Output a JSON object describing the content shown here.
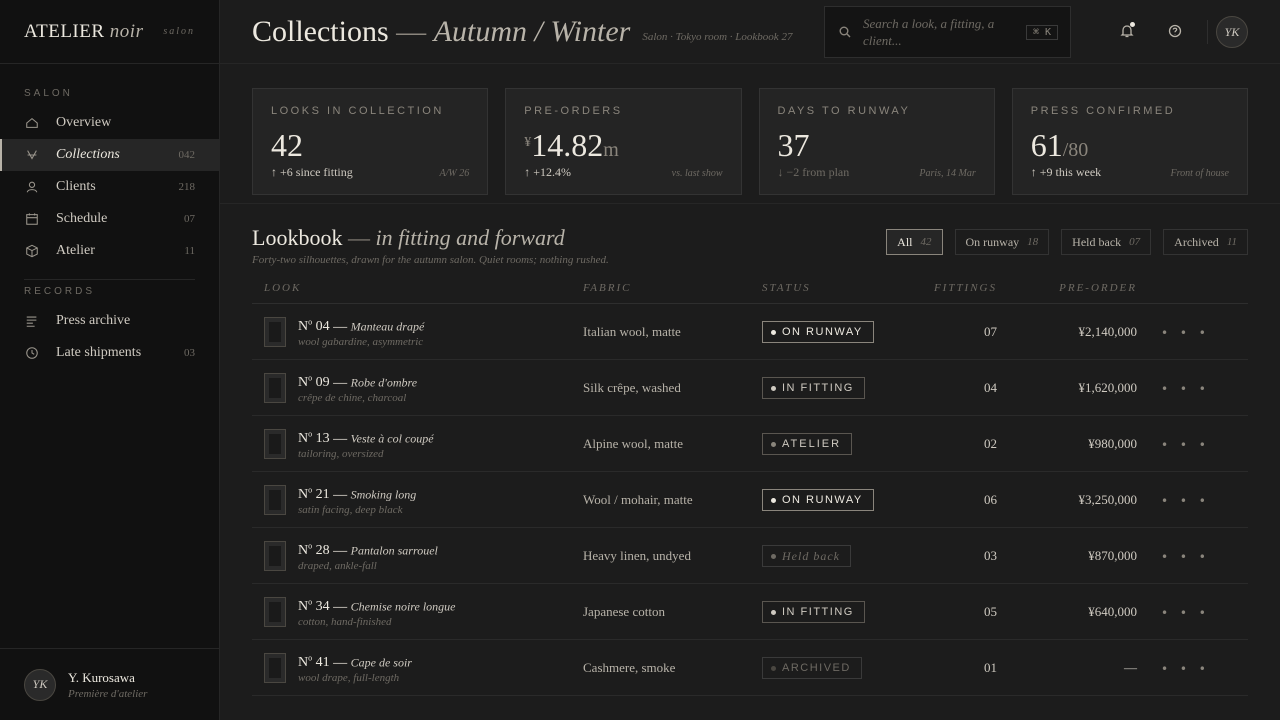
{
  "brand": {
    "name": "ATELIER",
    "name_italic": "noir",
    "tag": "salon"
  },
  "nav": {
    "section_salon": "SALON",
    "section_records": "RECORDS",
    "salon_items": [
      {
        "label": "Overview",
        "count": "",
        "icon": "home-icon"
      },
      {
        "label": "Collections",
        "count": "042",
        "icon": "hanger-icon"
      },
      {
        "label": "Clients",
        "count": "218",
        "icon": "user-icon"
      },
      {
        "label": "Schedule",
        "count": "07",
        "icon": "calendar-icon"
      },
      {
        "label": "Atelier",
        "count": "11",
        "icon": "box-icon"
      }
    ],
    "record_items": [
      {
        "label": "Press archive",
        "count": "",
        "icon": "list-icon"
      },
      {
        "label": "Late shipments",
        "count": "03",
        "icon": "clock-icon"
      }
    ]
  },
  "user": {
    "initials": "YK",
    "name": "Y. Kurosawa",
    "role": "Première d'atelier"
  },
  "header": {
    "title": "Collections",
    "title_dash": "—",
    "title_italic": "Autumn / Winter",
    "crumb": "Salon · Tokyo room · Lookbook 27",
    "search_placeholder": "Search a look, a fitting, a client...",
    "search_kbd": "⌘ K",
    "avatar": "YK"
  },
  "kpis": [
    {
      "label": "LOOKS IN COLLECTION",
      "prefix": "",
      "value": "42",
      "suffix": "",
      "delta": "↑ +6 since fitting",
      "down": false,
      "note": "A/W 26"
    },
    {
      "label": "PRE-ORDERS",
      "prefix": "¥",
      "value": "14.82",
      "suffix": "m",
      "delta": "↑ +12.4%",
      "down": false,
      "note": "vs. last show"
    },
    {
      "label": "DAYS TO RUNWAY",
      "prefix": "",
      "value": "37",
      "suffix": "",
      "delta": "↓ −2 from plan",
      "down": true,
      "note": "Paris, 14 Mar"
    },
    {
      "label": "PRESS CONFIRMED",
      "prefix": "",
      "value": "61",
      "suffix": "/80",
      "delta": "↑ +9 this week",
      "down": false,
      "note": "Front of house"
    }
  ],
  "lookbook": {
    "title": "Lookbook",
    "title_dash": "—",
    "title_italic": "in fitting and forward",
    "subtitle": "Forty-two silhouettes, drawn for the autumn salon. Quiet rooms; nothing rushed.",
    "filters": [
      {
        "label": "All",
        "count": "42"
      },
      {
        "label": "On runway",
        "count": "18"
      },
      {
        "label": "Held back",
        "count": "07"
      },
      {
        "label": "Archived",
        "count": "11"
      }
    ],
    "columns": {
      "look": "LOOK",
      "fabric": "FABRIC",
      "status": "STATUS",
      "fittings": "FITTINGS",
      "preorder": "PRE-ORDER"
    },
    "rows": [
      {
        "no": "04",
        "name": "Manteau drapé",
        "desc": "wool gabardine, asymmetric",
        "fabric": "Italian wool, matte",
        "status": "ON RUNWAY",
        "skind": "st-run",
        "fittings": "07",
        "preorder": "¥2,140,000"
      },
      {
        "no": "09",
        "name": "Robe d'ombre",
        "desc": "crêpe de chine, charcoal",
        "fabric": "Silk crêpe, washed",
        "status": "IN FITTING",
        "skind": "st-fit",
        "fittings": "04",
        "preorder": "¥1,620,000"
      },
      {
        "no": "13",
        "name": "Veste à col coupé",
        "desc": "tailoring, oversized",
        "fabric": "Alpine wool, matte",
        "status": "ATELIER",
        "skind": "st-atl",
        "fittings": "02",
        "preorder": "¥980,000"
      },
      {
        "no": "21",
        "name": "Smoking long",
        "desc": "satin facing, deep black",
        "fabric": "Wool / mohair, matte",
        "status": "ON RUNWAY",
        "skind": "st-run",
        "fittings": "06",
        "preorder": "¥3,250,000"
      },
      {
        "no": "28",
        "name": "Pantalon sarrouel",
        "desc": "draped, ankle-fall",
        "fabric": "Heavy linen, undyed",
        "status": "Held back",
        "skind": "st-held",
        "fittings": "03",
        "preorder": "¥870,000"
      },
      {
        "no": "34",
        "name": "Chemise noire longue",
        "desc": "cotton, hand-finished",
        "fabric": "Japanese cotton",
        "status": "IN FITTING",
        "skind": "st-fit",
        "fittings": "05",
        "preorder": "¥640,000"
      },
      {
        "no": "41",
        "name": "Cape de soir",
        "desc": "wool drape, full-length",
        "fabric": "Cashmere, smoke",
        "status": "ARCHIVED",
        "skind": "st-arc",
        "fittings": "01",
        "preorder": "—"
      }
    ]
  },
  "row_more": "• • •",
  "colors": {
    "bg": "#1c1c1c",
    "sidebar": "#111111",
    "text": "#ece8df",
    "muted": "#6e6a63",
    "accent": "#b8b3a9"
  }
}
